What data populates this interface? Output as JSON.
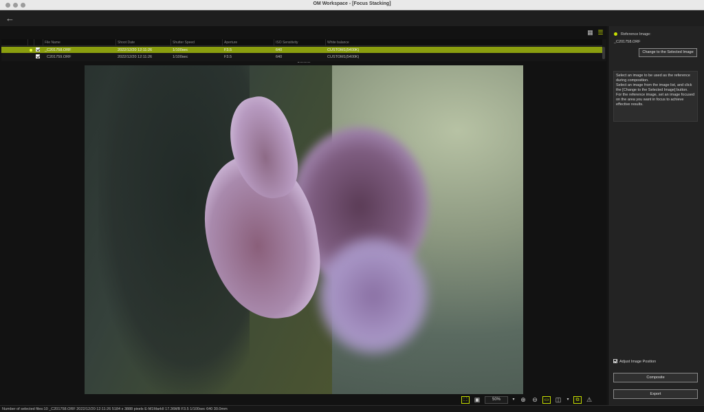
{
  "window": {
    "title": "OM Workspace - [Focus Stacking]"
  },
  "toolbar": {
    "back_icon": "←"
  },
  "view_buttons": {
    "grid_icon": "▦",
    "list_icon": "☰"
  },
  "filelist": {
    "columns": [
      "File Name",
      "Shoot Date",
      "Shutter Speed",
      "Aperture",
      "ISO Sensitivity",
      "White balance"
    ],
    "rows": [
      {
        "file": "_C201758.ORF",
        "date": "2022/12/20 12:11:26",
        "shutter": "1/100sec",
        "aperture": "F3.5",
        "iso": "640",
        "wb": "CUSTOM1(5400K)",
        "selected": true,
        "reference": true
      },
      {
        "file": "C201759.ORF",
        "date": "2022/12/20 12:11:26",
        "shutter": "1/100sec",
        "aperture": "F3.5",
        "iso": "640",
        "wb": "CUSTOM1(5400K)",
        "selected": false,
        "reference": false
      }
    ]
  },
  "right_panel": {
    "reference_label": "Reference Image:",
    "reference_file": "_C201758.ORF",
    "change_button": "Change to the Selected Image",
    "info_text": "Select an image to be used as the reference during composition.\nSelect an image from the image list, and click the [Change to the Selected Image] button.\nFor the reference image, set an image focused on the area you want in focus to achieve effective results.",
    "adjust_label": "Adjust Image Position",
    "composite_button": "Composite",
    "export_button": "Export"
  },
  "zoom": {
    "value": "50%"
  },
  "status": {
    "text": "Number of selected files:10  _C201758.ORF  2022/12/20 12:11:26  5184 x 3888 pixels  E-M1MarkII  17.36MB  F3.5  1/100sec  640  30.0mm"
  },
  "colors": {
    "accent": "#c8e000",
    "selection": "#8a9e0f"
  }
}
